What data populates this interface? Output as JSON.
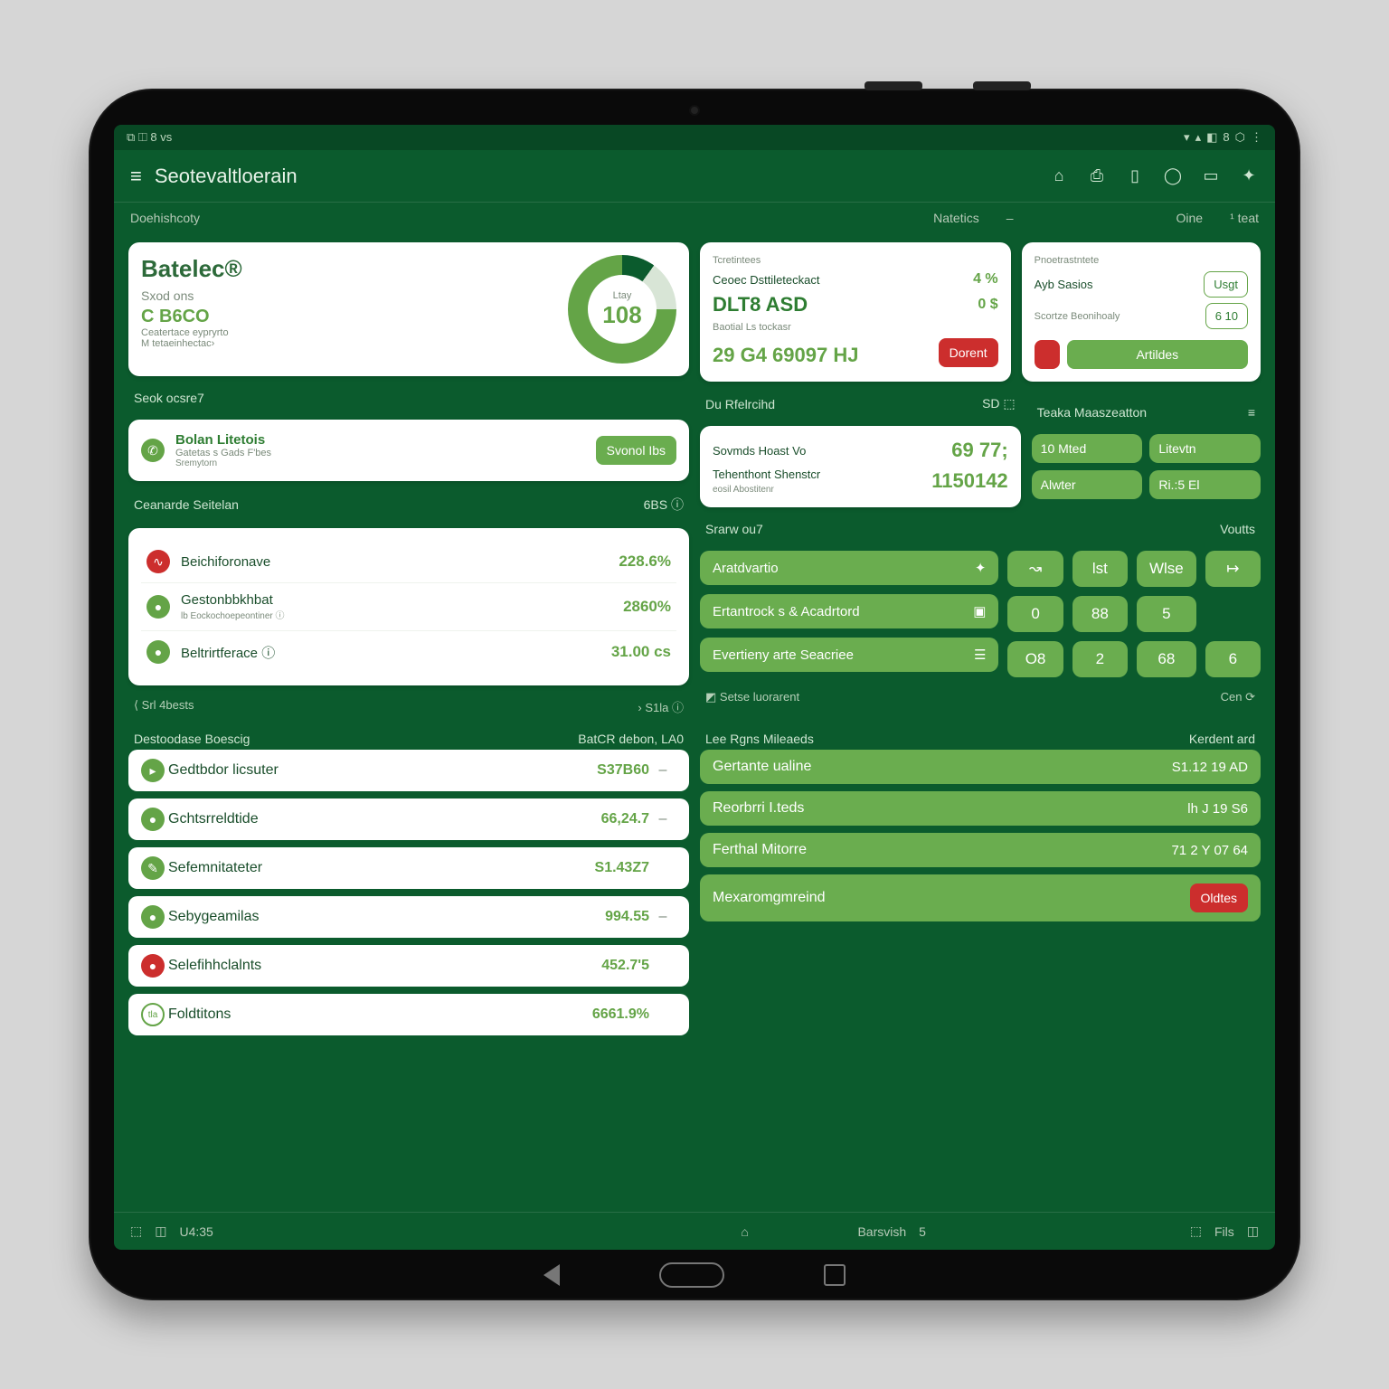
{
  "status_left": "⧉ ◫ 8 vs",
  "status_right": [
    "▾",
    "▴",
    "◧",
    "8",
    "⬡",
    "⋮"
  ],
  "app_title": "Seotevaltloerain",
  "appbar_icons": [
    "headphones-icon",
    "printer-icon",
    "bookmark-icon",
    "tip-icon",
    "display-icon",
    "settings-icon"
  ],
  "sections": {
    "left": "Doehishcoty",
    "mid": "Natetics",
    "mid_icon": "–",
    "r1": "Oine",
    "r2": "¹ teat"
  },
  "hero": {
    "title": "Batelec®",
    "sub": "Sxod ons",
    "code": "C B6CO",
    "tiny1": "Ceatertace eypryrto",
    "tiny2": "M tetaeinhectac›",
    "donut_top": "Ltay",
    "donut_val": "108"
  },
  "cluster": {
    "a": {
      "hdr": "Tcretintees",
      "l1": "Ceoec Dsttileteckact",
      "v1": "4 %",
      "l2": "DLT8 ASD",
      "v2": "0 $",
      "l3": "Baotial Ls tockasr",
      "big": "29 G4 69097 HJ",
      "btn": "Dorent"
    },
    "b": {
      "hdr": "Pnoetrastntete",
      "l1": "Ayb Sasios",
      "v1": "Usgt",
      "l2": "Scortze Beonihoaly",
      "v2": "6 10",
      "btn": "Artildes"
    }
  },
  "left_sec1_label": "Seok ocsre7",
  "left_sec1": {
    "icon_label": "Bolan Litetois",
    "sub": "Gatetas s Gads F'bes",
    "btn": "Svonol Ibs",
    "small": "Sremytorn"
  },
  "left_sec2_label": "Ceanarde Seitelan",
  "left_sec2_right": "6BS ⓘ",
  "left_list": [
    {
      "c": "r",
      "t": "Beichiforonave",
      "v": "228.6%"
    },
    {
      "c": "g",
      "t": "Gestonbbkhbat",
      "s": "lb Eockochoepeontiner ⓘ",
      "v": "2860%"
    },
    {
      "c": "g",
      "t": "Beltrirtferace ⓘ",
      "v": "31.00 cs"
    }
  ],
  "left_footer_l": "⟨ Srl 4bests",
  "left_footer_r": "› S1la ⓘ",
  "right_sec1_label": "Du Rfelrcihd",
  "right_sec1_right": "SD ⬚",
  "right_kv": [
    {
      "t": "Sovmds Hoast Vo",
      "v": "69 77;"
    },
    {
      "t": "Tehenthont Shenstcr",
      "s": "eosil Abostitenr",
      "v": "1150142"
    }
  ],
  "right_side_label": "Teaka Maaszeatton",
  "right_side_icon": "≡",
  "right_side_grid": [
    [
      "10 Mted",
      "Litevtn"
    ],
    [
      "Alwter",
      "Ri.:5 El"
    ]
  ],
  "stats_label": "Srarw ou7",
  "stats_right": "Voutts",
  "stats_rows": [
    {
      "t": "Aratdvartio",
      "i": "✦"
    },
    {
      "t": "Ertantrock s & Acadrtord",
      "i": "▣"
    },
    {
      "t": "Evertieny arte Seacriee",
      "i": "☰"
    }
  ],
  "stats_grid": [
    [
      "↝",
      "lst",
      "Wlse",
      "↦"
    ],
    [
      "0",
      "88",
      "5",
      ""
    ],
    [
      "O8",
      "2",
      "68",
      "6"
    ]
  ],
  "stats_footer_l": "◩ Setse luorarent",
  "stats_footer_r": "Cen ⟳",
  "bottom_left_label": "Destoodase Boescig",
  "bottom_left_right": "BatCR debon, LA0",
  "bottom_left": [
    {
      "c": "g",
      "t": "Gedtbdor licsuter",
      "v": "S37B60",
      "m": "–"
    },
    {
      "c": "g",
      "t": "Gchtsrreldtide",
      "v": "66,24.7",
      "m": "–"
    },
    {
      "c": "g",
      "t": "Sefemnitateter",
      "v": "S1.43Z7",
      "m": ""
    },
    {
      "c": "g",
      "t": "Sebygeamilas",
      "v": "994.55",
      "m": "–"
    },
    {
      "c": "r",
      "t": "Selefihhclalnts",
      "v": "452.7'5",
      "m": ""
    },
    {
      "c": "w",
      "t": "Foldtitons",
      "p": "tla",
      "v": "6661.9%",
      "m": ""
    }
  ],
  "bottom_right_label": "Lee Rgns Mileaeds",
  "bottom_right_right": "Kerdent ard",
  "bottom_right": [
    {
      "t": "Gertante ualine",
      "v": "S1.12 19 AD"
    },
    {
      "t": "Reorbrri I.teds",
      "v": "lh J 19 S6"
    },
    {
      "t": "Ferthal Mitorre",
      "v": "71 2 Y 07 64"
    },
    {
      "t": "Mexaromgmreind",
      "btn": "Oldtes"
    }
  ],
  "footer": {
    "l1": "⬚",
    "l2": "◫",
    "l3": "U4:35",
    "mid_icon": "⌂",
    "r0": "Barsvish",
    "r0v": "5",
    "r1": "⬚",
    "r2": "Fils",
    "r3": "◫"
  }
}
